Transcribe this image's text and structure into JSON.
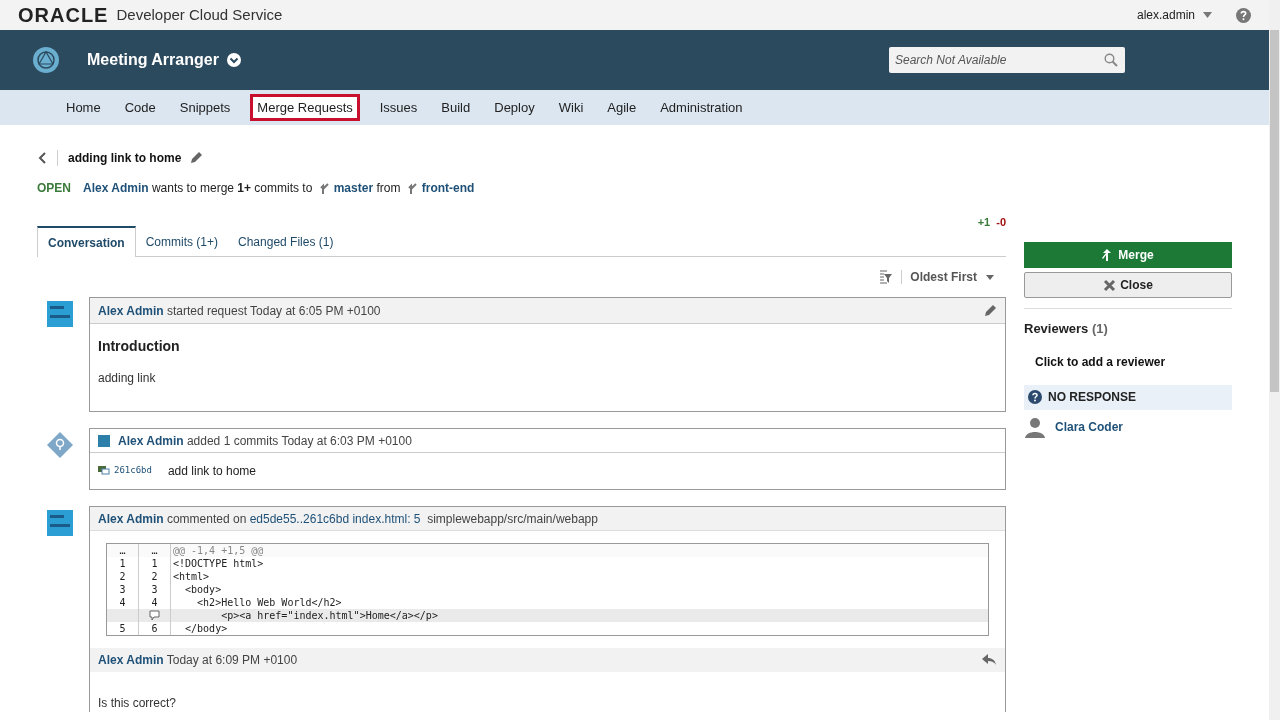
{
  "header": {
    "brand": "ORACLE",
    "product": "Developer Cloud Service",
    "user": "alex.admin"
  },
  "project": {
    "name": "Meeting Arranger",
    "search_placeholder": "Search Not Available"
  },
  "nav": [
    {
      "label": "Home",
      "selected": false
    },
    {
      "label": "Code",
      "selected": false
    },
    {
      "label": "Snippets",
      "selected": false
    },
    {
      "label": "Merge Requests",
      "selected": true
    },
    {
      "label": "Issues",
      "selected": false
    },
    {
      "label": "Build",
      "selected": false
    },
    {
      "label": "Deploy",
      "selected": false
    },
    {
      "label": "Wiki",
      "selected": false
    },
    {
      "label": "Agile",
      "selected": false
    },
    {
      "label": "Administration",
      "selected": false
    }
  ],
  "request": {
    "title": "adding link to home",
    "status": "OPEN",
    "author": "Alex Admin",
    "text_1": "wants to merge **1+** commits to",
    "target": "master",
    "text_2": "from",
    "source": "front-end",
    "added": "+1",
    "removed": "-0"
  },
  "tabs": [
    {
      "label": "Conversation",
      "selected": true
    },
    {
      "label": "Commits (1+)",
      "selected": false
    },
    {
      "label": "Changed Files (1)",
      "selected": false
    }
  ],
  "sort": "Oldest First",
  "timeline": [
    {
      "kind": "request",
      "author": "Alex Admin",
      "text": "started request Today at 6:05 PM +0100",
      "heading": "Introduction",
      "body": "adding link"
    },
    {
      "kind": "commits",
      "author": "Alex Admin",
      "text": "added 1 commits Today at 6:03 PM +0100",
      "commits": [
        {
          "hash": "261c6bd",
          "message": "add link to home"
        }
      ]
    },
    {
      "kind": "comment",
      "author": "Alex Admin",
      "action": "commented on",
      "range": "ed5de55..261c6bd",
      "file": "index.html: 5",
      "path": "simplewebapp/src/main/webapp",
      "diff": [
        {
          "kind": "hunk",
          "old": "…",
          "new": "…",
          "code": "@@ -1,4 +1,5 @@"
        },
        {
          "kind": "context",
          "old": "1",
          "new": "1",
          "code": "<!DOCTYPE html>"
        },
        {
          "kind": "context",
          "old": "2",
          "new": "2",
          "code": "<html>"
        },
        {
          "kind": "context",
          "old": "3",
          "new": "3",
          "code": "  <body>"
        },
        {
          "kind": "context",
          "old": "4",
          "new": "4",
          "code": "    <h2>Hello Web World</h2>"
        },
        {
          "kind": "commented",
          "code": "        <p><a href=\"index.html\">Home</a></p>"
        },
        {
          "kind": "context",
          "old": "5",
          "new": "6",
          "code": "  </body>"
        }
      ],
      "reply": {
        "author": "Alex Admin",
        "time": "Today at 6:09 PM +0100",
        "body": "Is this correct?"
      }
    }
  ],
  "actions": {
    "merge": "Merge",
    "close": "Close"
  },
  "reviewers": {
    "title": "Reviewers",
    "count": "(1)",
    "add": "Click to add a reviewer",
    "groups": [
      {
        "status": "NO RESPONSE",
        "people": [
          "Clara Coder"
        ]
      }
    ]
  }
}
